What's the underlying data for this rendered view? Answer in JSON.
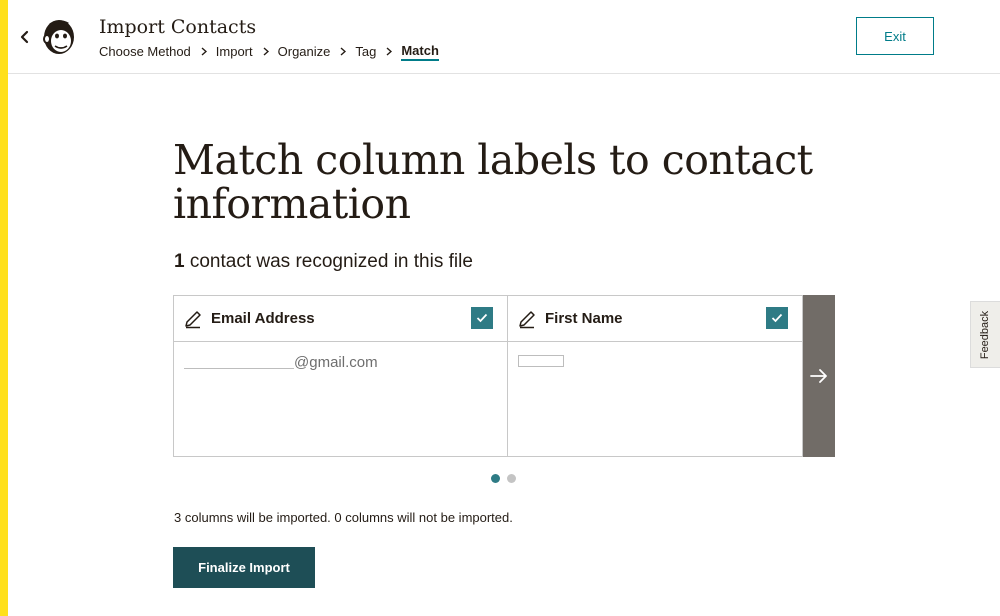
{
  "header": {
    "title": "Import Contacts",
    "back_icon": "chevron-left-icon",
    "logo_icon": "mailchimp-freddie-logo",
    "breadcrumb": [
      {
        "label": "Choose Method",
        "active": false
      },
      {
        "label": "Import",
        "active": false
      },
      {
        "label": "Organize",
        "active": false
      },
      {
        "label": "Tag",
        "active": false
      },
      {
        "label": "Match",
        "active": true
      }
    ],
    "exit_label": "Exit"
  },
  "main": {
    "heading": "Match column labels to contact information",
    "recognized": {
      "count": "1",
      "text": " contact was recognized in this file"
    },
    "columns": [
      {
        "title": "Email Address",
        "value": "@gmail.com",
        "checked": true,
        "icon": "pencil-icon"
      },
      {
        "title": "First Name",
        "value": "",
        "checked": true,
        "icon": "pencil-icon"
      }
    ],
    "next_icon": "arrow-right-icon",
    "pagination": {
      "total": 2,
      "current": 1
    },
    "summary": "3 columns will be imported. 0 columns will not be imported.",
    "finalize_label": "Finalize Import"
  },
  "feedback_label": "Feedback",
  "colors": {
    "accent_strip": "#ffe01b",
    "teal": "#007c89",
    "check": "#2e7b85",
    "primary_button": "#1e4e56",
    "next_panel": "#716c67"
  }
}
